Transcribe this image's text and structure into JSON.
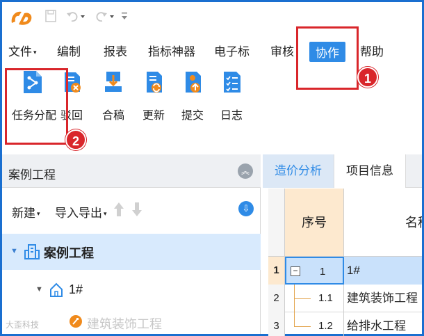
{
  "colors": {
    "accent": "#2f8be6",
    "highlight": "#d9262b",
    "frame": "#1a6fd0"
  },
  "titlebar": {
    "logo_icon": "app-logo-icon",
    "quick_access": [
      "save-icon",
      "undo-icon",
      "redo-icon",
      "customize-icon"
    ]
  },
  "menu": {
    "items": [
      {
        "label": "文件",
        "has_caret": true
      },
      {
        "label": "编制"
      },
      {
        "label": "报表"
      },
      {
        "label": "指标神器"
      },
      {
        "label": "电子标"
      },
      {
        "label": "审核"
      },
      {
        "label": "协作",
        "active": true
      },
      {
        "label": "帮助"
      }
    ]
  },
  "ribbon": {
    "buttons": [
      {
        "label": "任务分配",
        "icon": "task-assign-icon"
      },
      {
        "label": "驳回",
        "icon": "reject-icon"
      },
      {
        "label": "合稿",
        "icon": "merge-icon"
      },
      {
        "label": "更新",
        "icon": "update-icon"
      },
      {
        "label": "提交",
        "icon": "submit-icon"
      },
      {
        "label": "日志",
        "icon": "log-icon"
      }
    ]
  },
  "callouts": [
    {
      "number": "1"
    },
    {
      "number": "2"
    }
  ],
  "left_panel": {
    "title": "案例工程",
    "tools": {
      "new_label": "新建",
      "import_export_label": "导入导出"
    },
    "tree": [
      {
        "label": "案例工程",
        "icon": "building-icon"
      },
      {
        "label": "1#",
        "icon": "house-icon"
      },
      {
        "label": "建筑装饰工程",
        "icon": "unit-project-icon"
      }
    ]
  },
  "right_panel": {
    "tabs": [
      {
        "label": "造价分析",
        "active": true
      },
      {
        "label": "项目信息"
      }
    ],
    "grid": {
      "headers": {
        "seq": "序号",
        "name": "名称"
      },
      "rows": [
        {
          "row_num": "1",
          "seq": "1",
          "name": "1#",
          "selected": true
        },
        {
          "row_num": "2",
          "seq": "1.1",
          "name": "建筑装饰工程"
        },
        {
          "row_num": "3",
          "seq": "1.2",
          "name": "给排水工程"
        }
      ]
    }
  },
  "watermark": "大歪科技"
}
